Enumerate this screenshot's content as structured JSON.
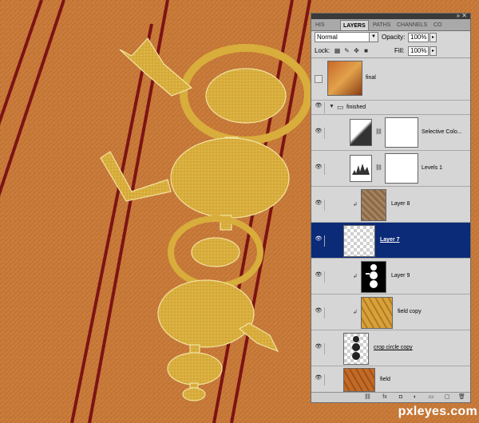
{
  "panel": {
    "tabs": [
      "HIS",
      "LAYERS",
      "PATHS",
      "CHANNELS",
      "CO"
    ],
    "blend_mode": "Normal",
    "opacity_label": "Opacity:",
    "opacity_value": "100%",
    "lock_label": "Lock:",
    "fill_label": "Fill:",
    "fill_value": "100%",
    "layers": [
      {
        "name": "final",
        "visible": false
      },
      {
        "name": "finished",
        "type": "group",
        "visible": true
      },
      {
        "name": "Selective Colo...",
        "visible": true,
        "adjustment": true
      },
      {
        "name": "Levels 1",
        "visible": true,
        "adjustment": true
      },
      {
        "name": "Layer 8",
        "visible": true
      },
      {
        "name": "Layer 7",
        "visible": true,
        "selected": true
      },
      {
        "name": "Layer 9",
        "visible": true
      },
      {
        "name": "field copy",
        "visible": true
      },
      {
        "name": "crop circle copy",
        "visible": true
      },
      {
        "name": "field",
        "visible": true
      }
    ]
  },
  "watermark": "pxleyes.com",
  "colors": {
    "field": "#c97a3a",
    "crop": "#d9b03e",
    "tracks": "#7c1414",
    "selection": "#0b2a78"
  },
  "icons": {
    "eye": "eye-icon",
    "folder": "folder-icon",
    "chain": "link-chain-icon",
    "clip": "clipping-arrow-icon"
  }
}
